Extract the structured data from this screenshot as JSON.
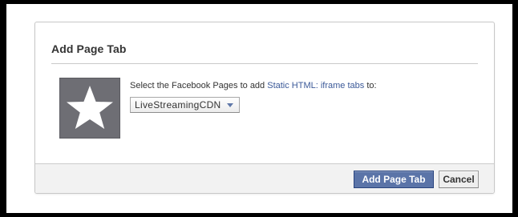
{
  "dialog": {
    "title": "Add Page Tab",
    "prompt_prefix": "Select the Facebook Pages to add ",
    "prompt_link": "Static HTML: iframe tabs",
    "prompt_suffix": " to:",
    "page_selector": {
      "selected_value": "LiveStreamingCDN"
    },
    "thumbnail": {
      "icon": "star-icon",
      "background_color": "#6e6e74"
    },
    "buttons": {
      "primary_label": "Add Page Tab",
      "cancel_label": "Cancel"
    }
  },
  "colors": {
    "link": "#3b5998",
    "primary_button": "#5b74a8",
    "frame_border": "#000000"
  }
}
